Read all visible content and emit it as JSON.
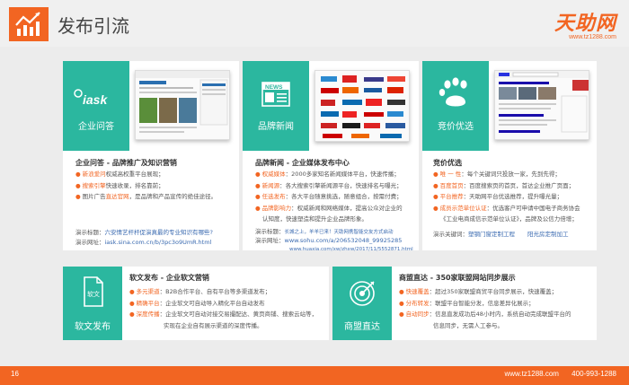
{
  "header": {
    "title": "发布引流",
    "brand": "天助网",
    "brand_url": "www.tz1288.com"
  },
  "cards": {
    "qa": {
      "panel_label": "企业问答",
      "title": "企业问答 - 品牌推广及知识营销",
      "rows": [
        {
          "key": "新浪爱问",
          "text": "权威高权重平台展现；"
        },
        {
          "key": "搜索引擎",
          "text": "快速收录，排名靠前；"
        },
        {
          "key": "",
          "pre": "图片广告",
          "mid": "直达官网",
          "text": "，是品牌和产品宣传的绝佳途径。"
        }
      ],
      "demo_title_label": "演示标题：",
      "demo_title": "六安情艺杆杆促演真最的专业知识有哪些?",
      "demo_url_label": "演示网址：",
      "demo_url": "iask.sina.com.cn/b/3pc3o9UmR.html"
    },
    "news": {
      "panel_label": "品牌新闻",
      "title": "品牌新闻 - 企业媒体发布中心",
      "rows": [
        {
          "key": "权威媒体",
          "text": "：2000多家知名新闻媒体平台，快速传播；"
        },
        {
          "key": "新闻源",
          "text": "：各大搜索引擎新闻源平台，快速排名与曝光；"
        },
        {
          "key": "任选发布",
          "text": "：各大平台随意挑选，随意组合，按需付费；"
        },
        {
          "key": "品牌影响力",
          "text": "：权威新闻和网络媒体，提高公众对企业的"
        },
        {
          "key": "",
          "text": "认知度，快速塑造和提升企业品牌形象。"
        }
      ],
      "demo_title_label": "演示标题：",
      "demo_title": "长城之上，羊羊已来！天助网携智能交友方式启动",
      "demo_url_label": "演示网址：",
      "demo_url": "www.sohu.com/a/206532048_99925285",
      "demo_url2": "www.huaxia.com/xw/zhxw/2017/11/5552871.html"
    },
    "bid": {
      "panel_label": "竞价优选",
      "title": "竞价优选",
      "rows": [
        {
          "key": "唯 一 性",
          "text": "：每个关键词只投放一家，先到先得；"
        },
        {
          "key": "百度首页",
          "text": "：百度搜索页的首页，首达企业推广页面；"
        },
        {
          "key": "平台推荐",
          "text": "：天助网平台优选推荐，提升曝光量；"
        },
        {
          "key": "成员示范单位认证",
          "text": "：优选客户可申请中国电子商务协会"
        },
        {
          "key": "",
          "text": "《工业电商成信示范单位认证》，品牌及公信力倍增；"
        }
      ],
      "demo_kw_label": "演示关键词：",
      "demo_kw1": "塑钢门窗定制工程",
      "demo_kw2": "阳光房定制加工"
    },
    "soft": {
      "panel_label": "软文发布",
      "title": "软文发布 - 企业软文营销",
      "rows": [
        {
          "key": "多元渠道",
          "text": "：B2B合作平台、自有平台等多渠道发布；"
        },
        {
          "key": "精确平台",
          "text": "：企业软文可自动导入精化平台自动发布"
        },
        {
          "key": "深度传播",
          "text": "：企业软文可自动对接交易撮配达、黄页商铺、搜索云站等，"
        },
        {
          "key": "",
          "text": "实现在企业自有展示渠道的深度传播。"
        }
      ]
    },
    "direct": {
      "panel_label": "商盟直达",
      "title": "商盟直达 - 350家联盟网站同步展示",
      "rows": [
        {
          "key": "快速覆盖",
          "text": "：超过350家联盟商贸平台同步展示，快速覆盖；"
        },
        {
          "key": "分布转发",
          "text": "：联盟平台智能分发，信息差异化展示；"
        },
        {
          "key": "自动同步",
          "text": "：信息直发成功后48小时内，系统自动完成联盟平台的"
        },
        {
          "key": "",
          "text": "信息同步，无需人工参与。"
        }
      ]
    }
  },
  "footer": {
    "page": "16",
    "url": "www.tz1288.com",
    "phone": "400-993-1288"
  }
}
